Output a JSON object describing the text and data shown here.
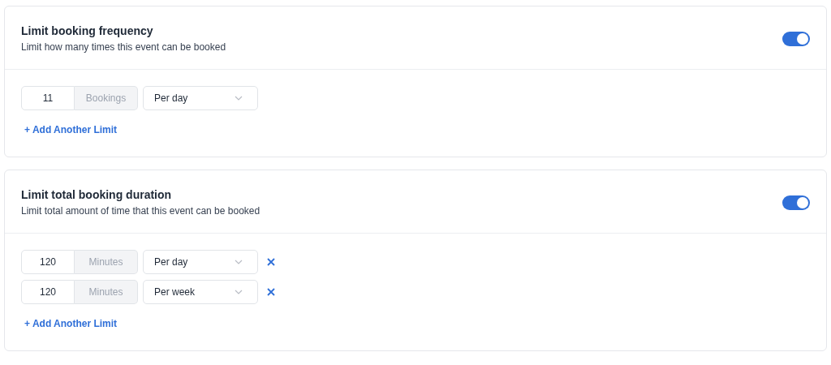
{
  "sections": [
    {
      "title": "Limit booking frequency",
      "description": "Limit how many times this event can be booked",
      "on": true,
      "limits": [
        {
          "value": "11",
          "unit": "Bookings",
          "period": "Per day",
          "removable": false
        }
      ],
      "add_link": "+ Add Another Limit"
    },
    {
      "title": "Limit total booking duration",
      "description": "Limit total amount of time that this event can be booked",
      "on": true,
      "limits": [
        {
          "value": "120",
          "unit": "Minutes",
          "period": "Per day",
          "removable": true
        },
        {
          "value": "120",
          "unit": "Minutes",
          "period": "Per week",
          "removable": true
        }
      ],
      "add_link": "+ Add Another Limit"
    }
  ]
}
